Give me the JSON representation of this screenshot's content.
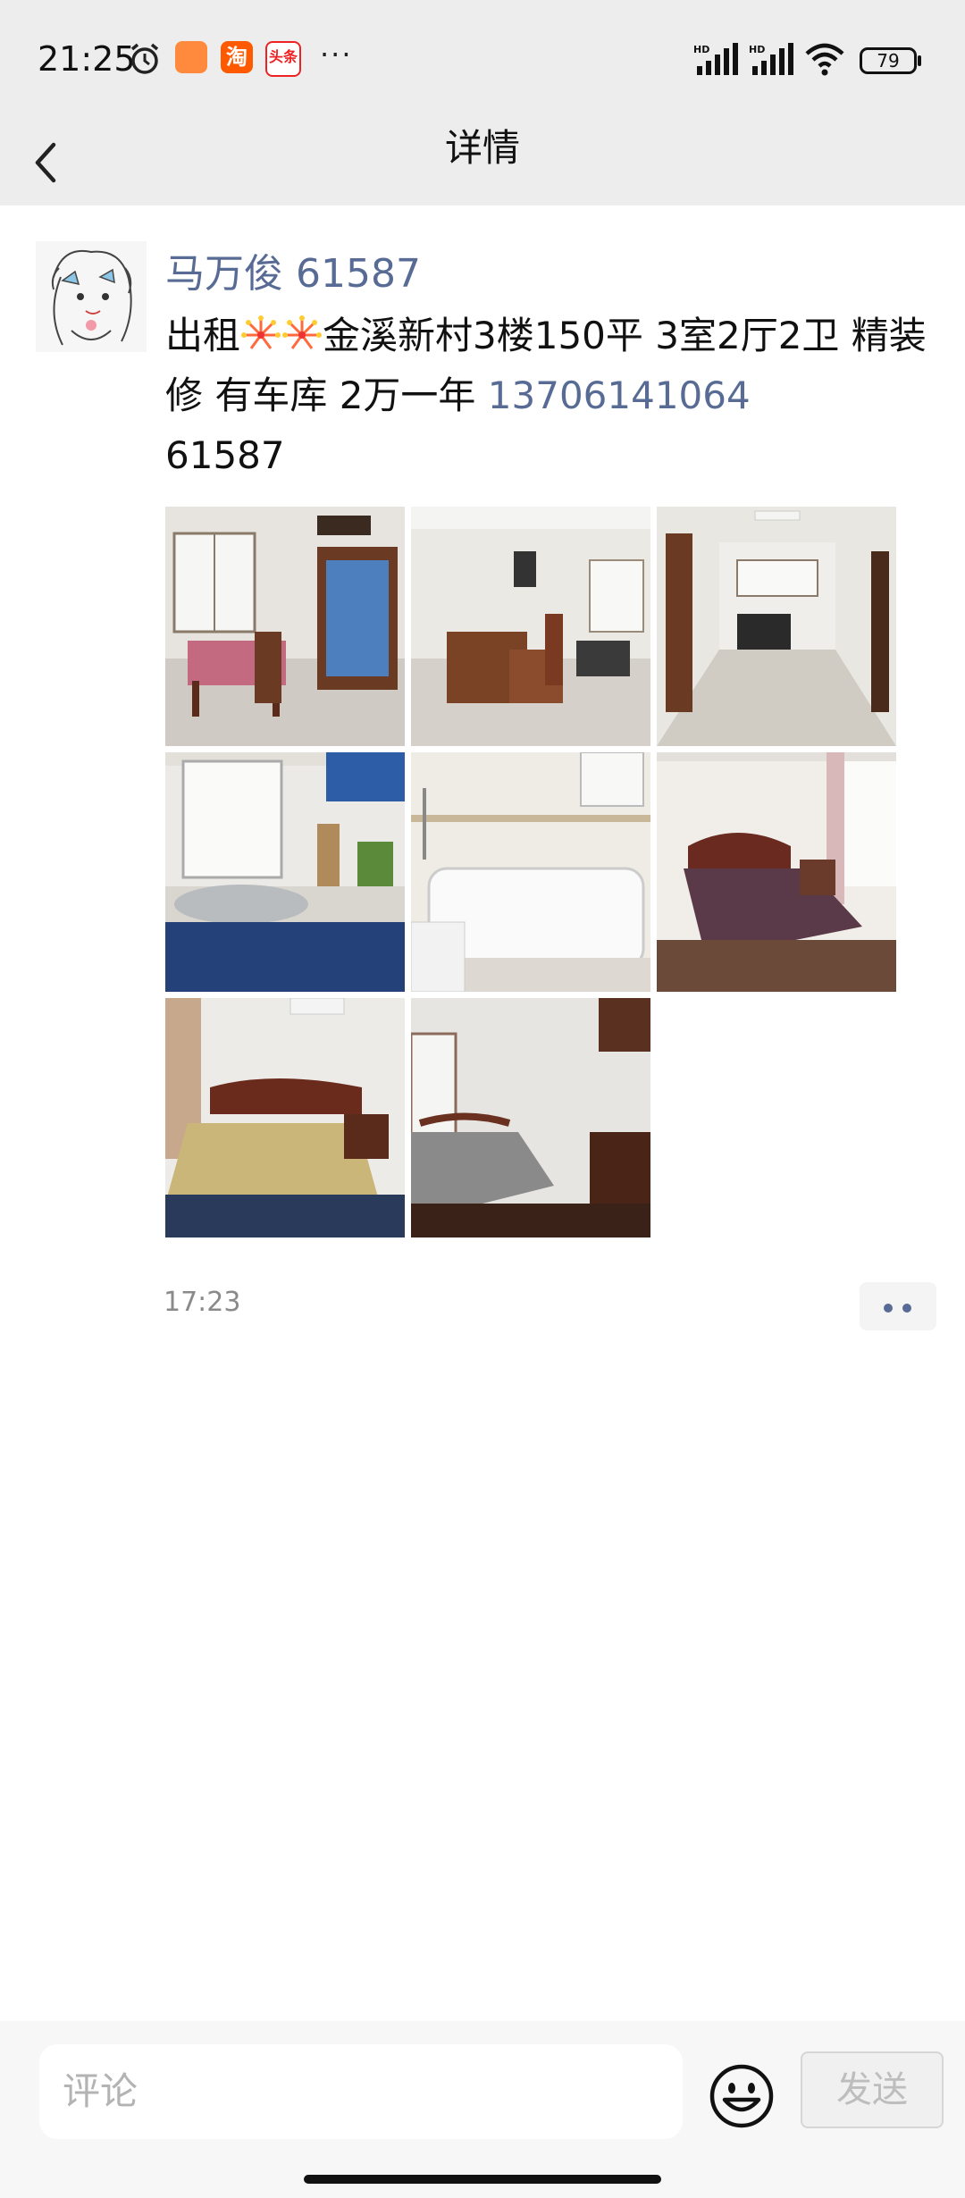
{
  "status_bar": {
    "time": "21:25",
    "more": "···",
    "app2_glyph": "淘",
    "app3_glyph": "头条",
    "battery": "79",
    "icons": [
      "alarm-icon",
      "shopping-app-icon",
      "taobao-icon",
      "toutiao-icon",
      "signal-icon",
      "signal-icon",
      "wifi-icon",
      "battery-icon"
    ]
  },
  "header": {
    "title": "详情",
    "back_icon": "chevron-left-icon"
  },
  "post": {
    "author": "马万俊 61587",
    "text_before_emoji": "出租",
    "emoji_name": "fireworks-emoji",
    "text_main": "金溪新村3楼150平  3室2厅2卫  精装修  有车库  2万一年 ",
    "phone": "13706141064",
    "text_after": "61587",
    "time": "17:23",
    "photos": [
      {
        "name": "photo-dining-room"
      },
      {
        "name": "photo-living-room"
      },
      {
        "name": "photo-hallway"
      },
      {
        "name": "photo-kitchen"
      },
      {
        "name": "photo-bathtub"
      },
      {
        "name": "photo-bedroom-1"
      },
      {
        "name": "photo-bedroom-2"
      },
      {
        "name": "photo-bedroom-3"
      }
    ]
  },
  "comment_bar": {
    "placeholder": "评论",
    "emoji_icon": "smiley-icon",
    "send_label": "发送"
  },
  "colors": {
    "link": "#576b95",
    "header_bg": "#ededed"
  }
}
